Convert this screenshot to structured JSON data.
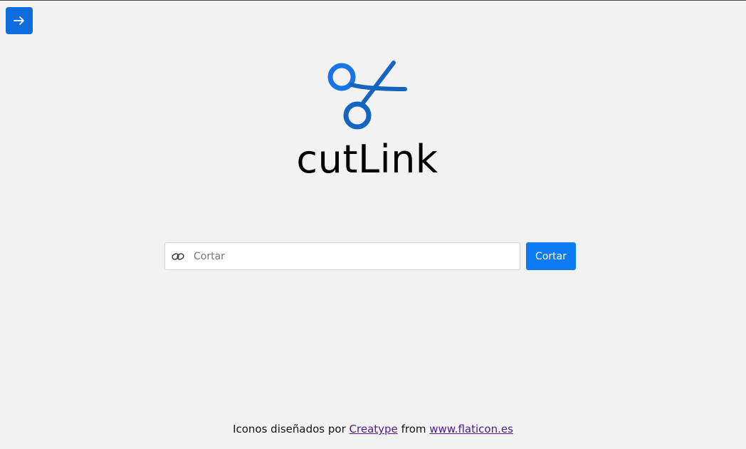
{
  "header": {
    "toggle_icon": "arrow-right-icon",
    "toggle_color": "#0d6ddf"
  },
  "logo": {
    "icon": "scissors-icon",
    "color": "#1a73e8",
    "brand_name": "cutLink"
  },
  "form": {
    "input_icon": "link-icon",
    "input_placeholder": "Cortar",
    "input_value": "",
    "submit_label": "Cortar",
    "submit_color": "#0d7bf3"
  },
  "footer": {
    "prefix": "Iconos diseñados por",
    "author_link": "Creatype",
    "middle": "from",
    "site_link": "www.flaticon.es"
  }
}
